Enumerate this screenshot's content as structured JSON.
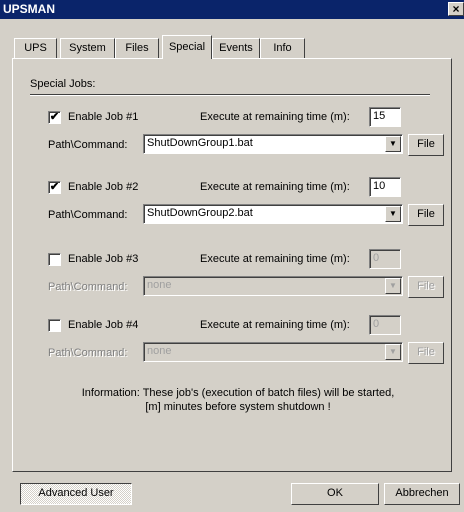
{
  "window": {
    "title": "UPSMAN",
    "close_glyph": "×"
  },
  "tabs": [
    {
      "label": "UPS"
    },
    {
      "label": "System"
    },
    {
      "label": "Files"
    },
    {
      "label": "Special"
    },
    {
      "label": "Events"
    },
    {
      "label": "Info"
    }
  ],
  "active_tab": "Special",
  "special": {
    "group_label": "Special Jobs:",
    "jobs": [
      {
        "enable_label": "Enable Job #1",
        "checked": true,
        "check_glyph": "✔",
        "time_label": "Execute at remaining time (m):",
        "time_value": "15",
        "path_label": "Path\\Command:",
        "path_value": "ShutDownGroup1.bat",
        "file_label": "File",
        "enabled": true
      },
      {
        "enable_label": "Enable Job #2",
        "checked": true,
        "check_glyph": "✔",
        "time_label": "Execute at remaining time (m):",
        "time_value": "10",
        "path_label": "Path\\Command:",
        "path_value": "ShutDownGroup2.bat",
        "file_label": "File",
        "enabled": true
      },
      {
        "enable_label": "Enable Job #3",
        "checked": false,
        "check_glyph": "",
        "time_label": "Execute at remaining time (m):",
        "time_value": "0",
        "path_label": "Path\\Command:",
        "path_value": "none",
        "file_label": "File",
        "enabled": false
      },
      {
        "enable_label": "Enable Job #4",
        "checked": false,
        "check_glyph": "",
        "time_label": "Execute at remaining time (m):",
        "time_value": "0",
        "path_label": "Path\\Command:",
        "path_value": "none",
        "file_label": "File",
        "enabled": false
      }
    ],
    "info_line1": "Information: These job's (execution of batch files) will be started,",
    "info_line2": "[m] minutes before system shutdown !"
  },
  "footer": {
    "advanced_label": "Advanced User",
    "ok_label": "OK",
    "cancel_label": "Abbrechen"
  },
  "icons": {
    "dropdown_arrow": "▼"
  },
  "colors": {
    "titlebar": "#0a246a",
    "face": "#d4d0c8"
  }
}
